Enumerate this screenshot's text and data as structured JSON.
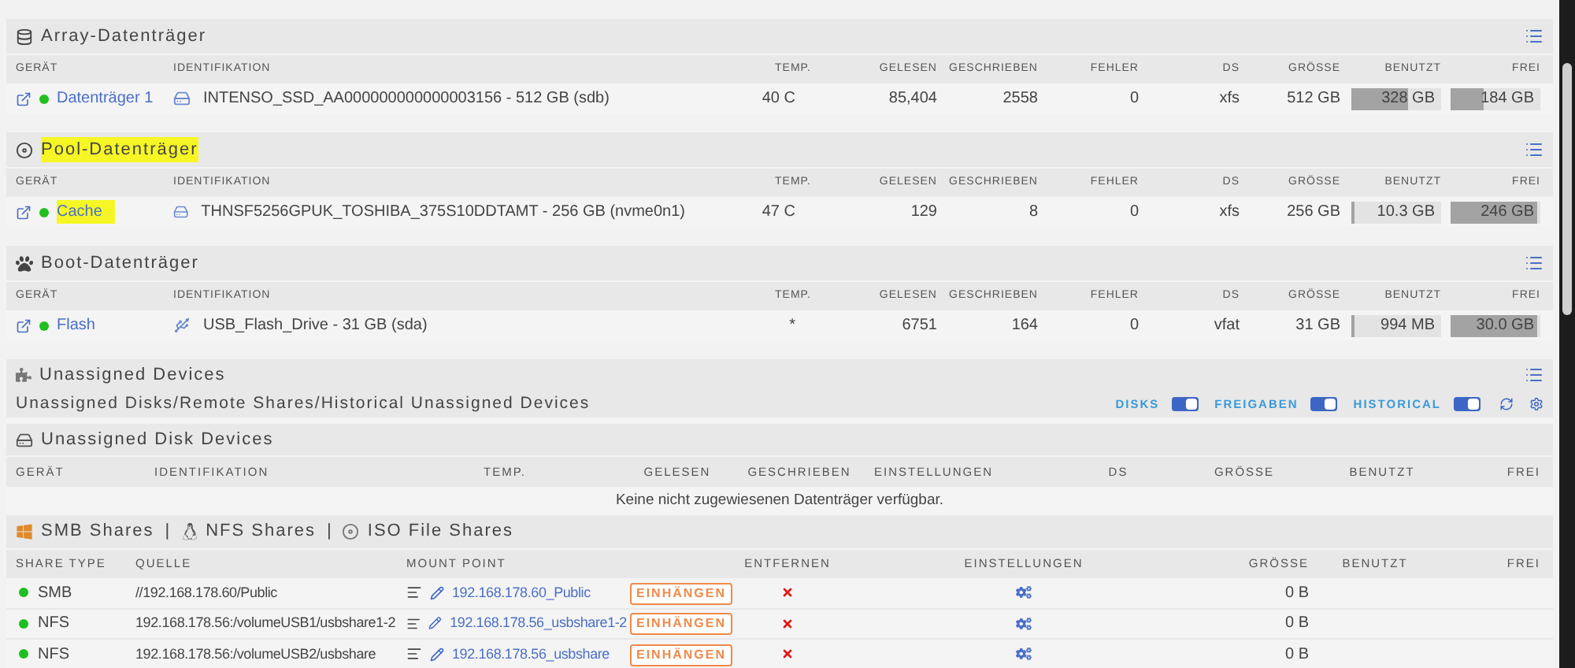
{
  "disk_sections": [
    {
      "title": "Array-Datenträger",
      "kind": "array",
      "highlighted": false,
      "columns": [
        "GERÄT",
        "IDENTIFIKATION",
        "TEMP.",
        "GELESEN",
        "GESCHRIEBEN",
        "FEHLER",
        "DS",
        "GRÖSSE",
        "BENUTZT",
        "FREI"
      ],
      "rows": [
        {
          "device": "Datenträger 1",
          "highlighted": false,
          "kind": "ssd",
          "identification": "INTENSO_SSD_AA000000000000003156 - 512 GB (sdb)",
          "temp": "40 C",
          "read": "85,404",
          "written": "2558",
          "errors": "0",
          "fs": "xfs",
          "size": "512 GB",
          "used": {
            "text": "328 GB",
            "level": 0.64
          },
          "free": {
            "text": "184 GB",
            "level": 0.36
          }
        }
      ]
    },
    {
      "title": "Pool-Datenträger",
      "kind": "pool",
      "highlighted": true,
      "columns": [
        "GERÄT",
        "IDENTIFIKATION",
        "TEMP.",
        "GELESEN",
        "GESCHRIEBEN",
        "FEHLER",
        "DS",
        "GRÖSSE",
        "BENUTZT",
        "FREI"
      ],
      "rows": [
        {
          "device": "Cache",
          "highlighted": true,
          "kind": "ssd",
          "identification": "THNSF5256GPUK_TOSHIBA_375S10DDTAMT - 256 GB (nvme0n1)",
          "temp": "47 C",
          "read": "129",
          "written": "8",
          "errors": "0",
          "fs": "xfs",
          "size": "256 GB",
          "used": {
            "text": "10.3 GB",
            "level": 0.04
          },
          "free": {
            "text": "246 GB",
            "level": 0.96
          }
        }
      ]
    },
    {
      "title": "Boot-Datenträger",
      "kind": "boot",
      "highlighted": false,
      "columns": [
        "GERÄT",
        "IDENTIFIKATION",
        "TEMP.",
        "GELESEN",
        "GESCHRIEBEN",
        "FEHLER",
        "DS",
        "GRÖSSE",
        "BENUTZT",
        "FREI"
      ],
      "rows": [
        {
          "device": "Flash",
          "highlighted": false,
          "kind": "usb",
          "identification": "USB_Flash_Drive - 31 GB (sda)",
          "temp": "*",
          "read": "6751",
          "written": "164",
          "errors": "0",
          "fs": "vfat",
          "size": "31 GB",
          "used": {
            "text": "994 MB",
            "level": 0.03
          },
          "free": {
            "text": "30.0 GB",
            "level": 0.97
          }
        }
      ]
    }
  ],
  "unassigned": {
    "title": "Unassigned Devices",
    "subtitle": "Unassigned Disks/Remote Shares/Historical Unassigned Devices",
    "toggles": [
      {
        "label": "DISKS",
        "on": true
      },
      {
        "label": "FREIGABEN",
        "on": true
      },
      {
        "label": "HISTORICAL",
        "on": true
      }
    ],
    "disk_devices": {
      "title": "Unassigned Disk Devices",
      "columns": [
        "GERÄT",
        "IDENTIFIKATION",
        "TEMP.",
        "GELESEN",
        "GESCHRIEBEN",
        "EINSTELLUNGEN",
        "DS",
        "GRÖSSE",
        "BENUTZT",
        "FREI"
      ],
      "message": "Keine nicht zugewiesenen Datenträger verfügbar."
    },
    "shares": {
      "titles": [
        {
          "kind": "windows",
          "text": "SMB Shares"
        },
        {
          "kind": "linux",
          "text": "NFS Shares"
        },
        {
          "kind": "disc",
          "text": "ISO File Shares"
        }
      ],
      "separator": "|",
      "columns": [
        "SHARE TYPE",
        "QUELLE",
        "MOUNT POINT",
        "ENTFERNEN",
        "EINSTELLUNGEN",
        "GRÖSSE",
        "BENUTZT",
        "FREI"
      ],
      "rows": [
        {
          "type": "SMB",
          "source": "//192.168.178.60/Public",
          "mount_point": "192.168.178.60_Public",
          "button": "EINHÄNGEN",
          "size": "0 B"
        },
        {
          "type": "NFS",
          "source": "192.168.178.56:/volumeUSB1/usbshare1-2",
          "mount_point": "192.168.178.56_usbshare1-2",
          "button": "EINHÄNGEN",
          "size": "0 B"
        },
        {
          "type": "NFS",
          "source": "192.168.178.56:/volumeUSB2/usbshare",
          "mount_point": "192.168.178.56_usbshare",
          "button": "EINHÄNGEN",
          "size": "0 B"
        }
      ]
    }
  }
}
